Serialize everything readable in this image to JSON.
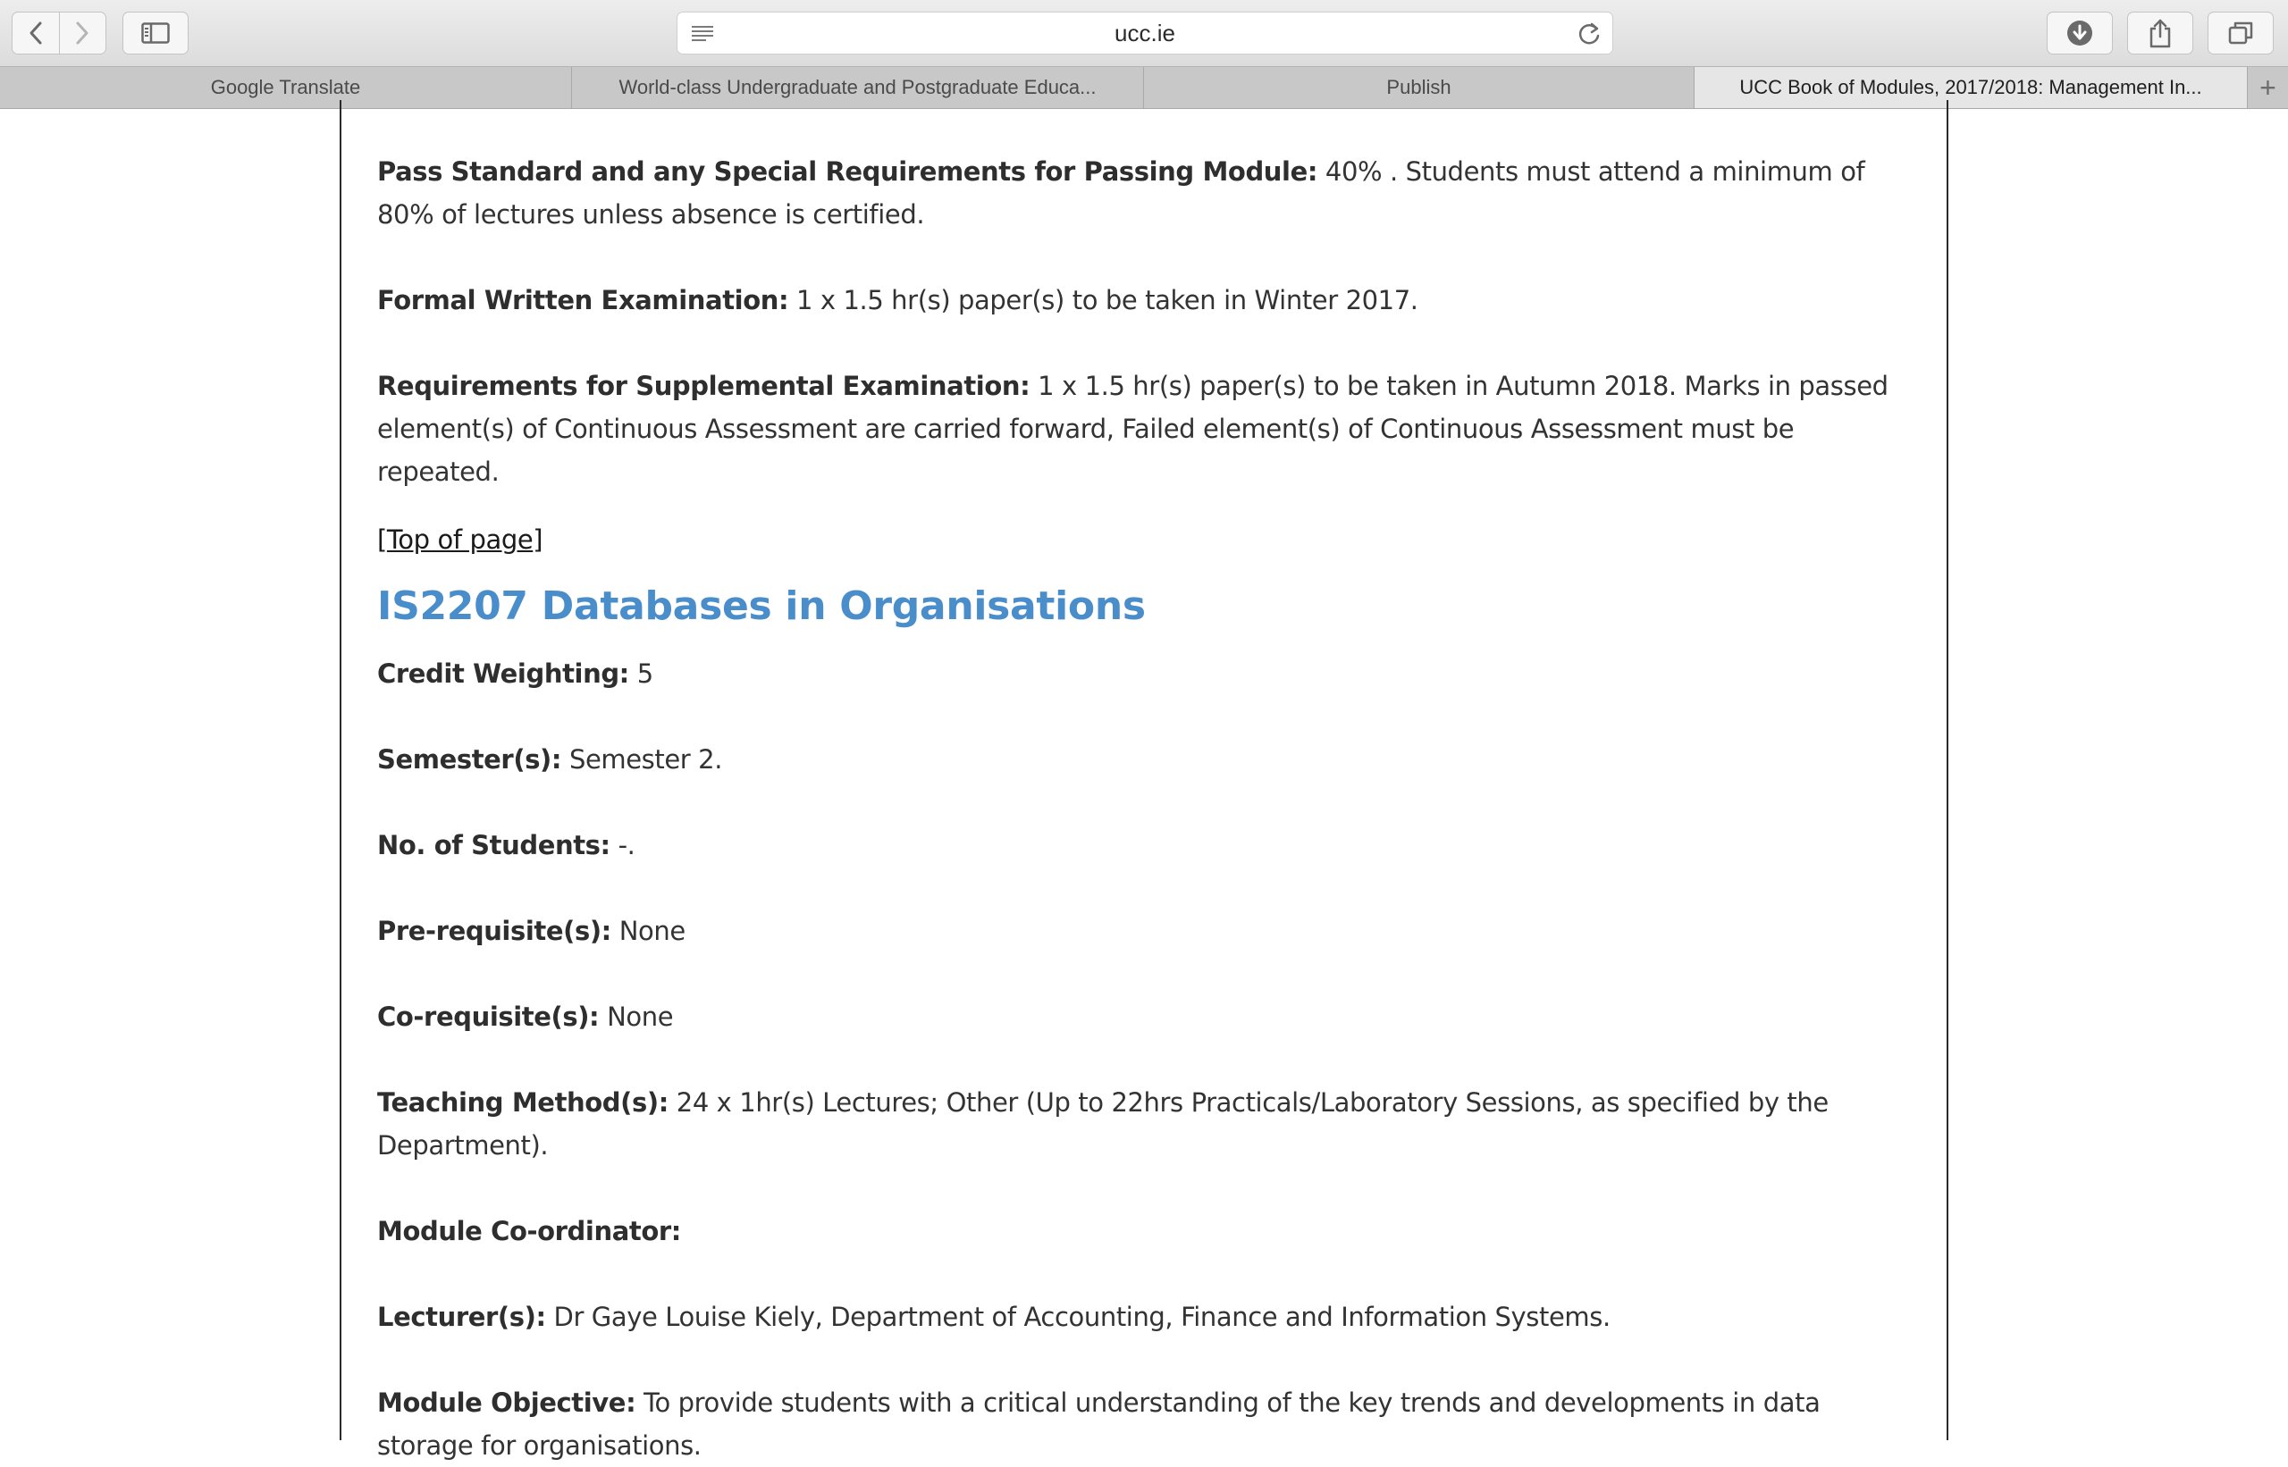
{
  "browser": {
    "url": "ucc.ie",
    "tabs": [
      {
        "label": "Google Translate",
        "active": false
      },
      {
        "label": "World-class Undergraduate and Postgraduate Educa...",
        "active": false
      },
      {
        "label": "Publish",
        "active": false
      },
      {
        "label": "UCC Book of Modules, 2017/2018: Management In...",
        "active": true
      }
    ],
    "new_tab_label": "+"
  },
  "page": {
    "pass_standard": {
      "label": "Pass Standard and any Special Requirements for Passing Module:",
      "value": "40% . Students must attend a minimum of 80% of lectures unless absence is certified."
    },
    "formal_exam": {
      "label": "Formal Written Examination:",
      "value": "1 x 1.5 hr(s) paper(s) to be taken in Winter 2017."
    },
    "supplemental": {
      "label": "Requirements for Supplemental Examination:",
      "value": "1 x 1.5 hr(s) paper(s) to be taken in Autumn 2018. Marks in passed element(s) of Continuous Assessment are carried forward, Failed element(s) of Continuous Assessment must be repeated."
    },
    "top_link": {
      "open": "[",
      "label": "Top of page",
      "close": "]"
    },
    "module_title": "IS2207 Databases in Organisations",
    "fields": {
      "credit_weighting": {
        "label": "Credit Weighting:",
        "value": "5"
      },
      "semesters": {
        "label": "Semester(s):",
        "value": "Semester 2."
      },
      "students": {
        "label": "No. of Students:",
        "value": "-."
      },
      "prerequisites": {
        "label": "Pre-requisite(s):",
        "value": "None"
      },
      "corequisites": {
        "label": "Co-requisite(s):",
        "value": "None"
      },
      "teaching": {
        "label": "Teaching Method(s):",
        "value": "24 x 1hr(s) Lectures; Other (Up to 22hrs Practicals/Laboratory Sessions, as specified by the Department)."
      },
      "coordinator": {
        "label": "Module Co-ordinator:",
        "value": ""
      },
      "lecturers": {
        "label": "Lecturer(s):",
        "value": "Dr Gaye Louise Kiely, Department of Accounting, Finance and Information Systems."
      },
      "objective": {
        "label": "Module Objective:",
        "value": "To provide students with a critical understanding of the key trends and developments in data storage for organisations."
      }
    }
  }
}
